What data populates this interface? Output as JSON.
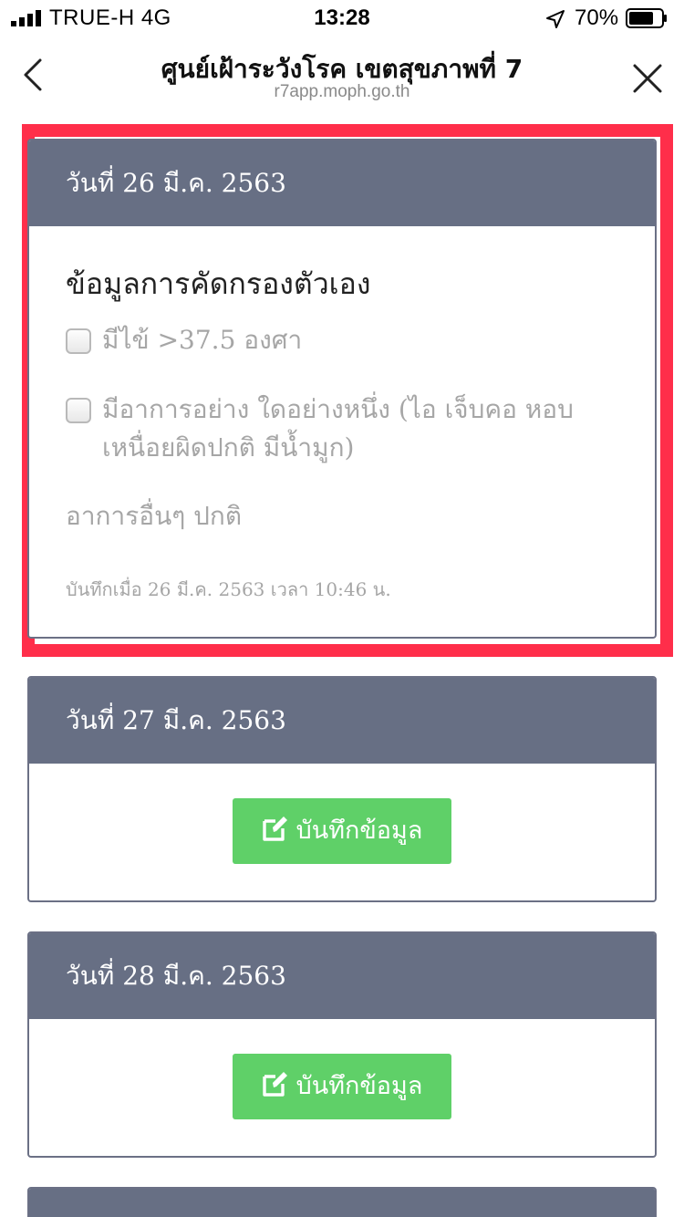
{
  "status_bar": {
    "carrier": "TRUE-H  4G",
    "time": "13:28",
    "battery": "70%"
  },
  "nav": {
    "title": "ศูนย์เฝ้าระวังโรค เขตสุขภาพที่ 7",
    "url": "r7app.moph.go.th"
  },
  "cards": [
    {
      "date": "วันที่ 26 มี.ค. 2563",
      "screening_title": "ข้อมูลการคัดกรองตัวเอง",
      "symptoms": [
        {
          "label": "มีไข้ >37.5 องศา",
          "checked": false
        },
        {
          "label": "มีอาการอย่าง ใดอย่างหนึ่ง (ไอ เจ็บคอ หอบ เหนื่อยผิดปกติ มีน้ำมูก)",
          "checked": false
        }
      ],
      "other": "อาการอื่นๆ ปกติ",
      "saved": "บันทึกเมื่อ 26 มี.ค. 2563 เวลา 10:46 น."
    },
    {
      "date": "วันที่ 27 มี.ค. 2563",
      "button": "บันทึกข้อมูล"
    },
    {
      "date": "วันที่ 28 มี.ค. 2563",
      "button": "บันทึกข้อมูล"
    }
  ],
  "colors": {
    "header": "#676f84",
    "button": "#5fd068",
    "highlight": "#ff2e4a"
  }
}
